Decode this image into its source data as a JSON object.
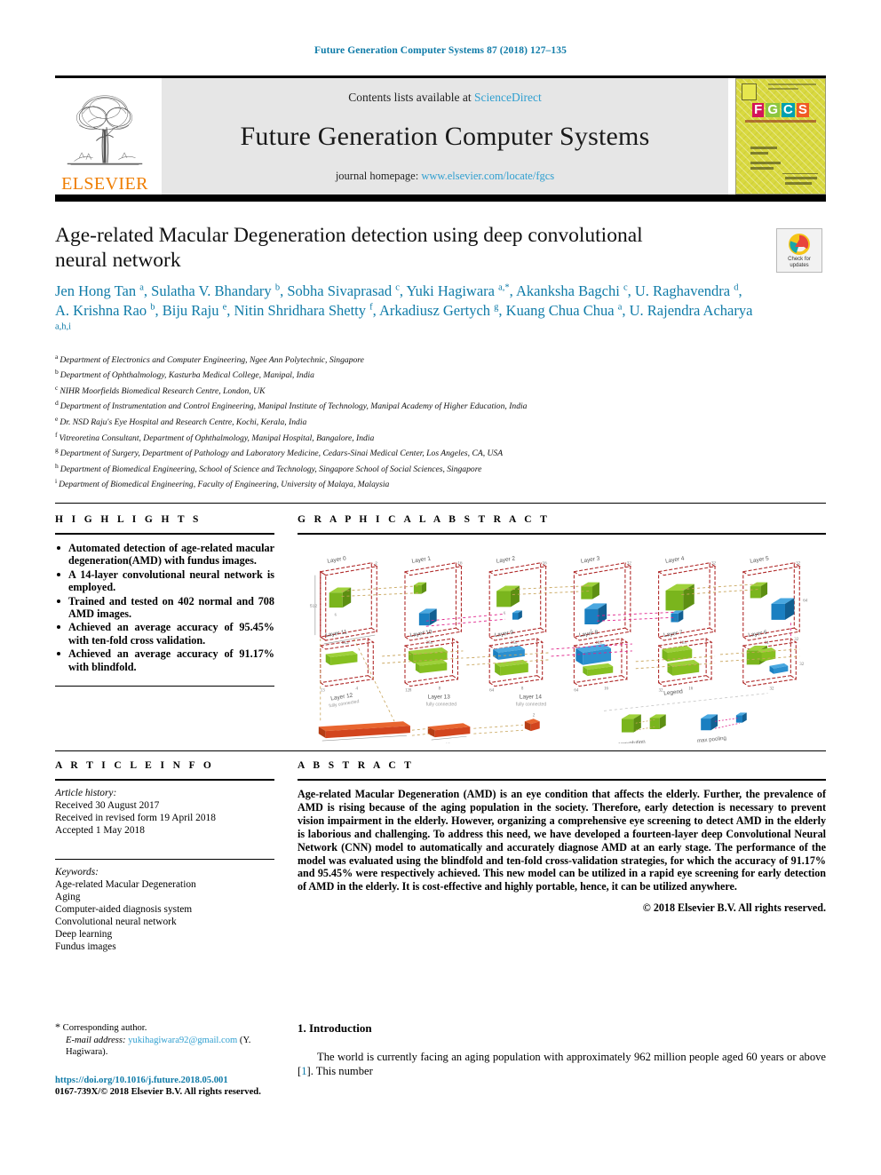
{
  "running_head": "Future Generation Computer Systems 87 (2018) 127–135",
  "masthead": {
    "elsevier_wordmark": "ELSEVIER",
    "contents_prefix": "Contents lists available at",
    "contents_link": "ScienceDirect",
    "journal_title": "Future Generation Computer Systems",
    "homepage_prefix": "journal homepage:",
    "homepage_link": "www.elsevier.com/locate/fgcs",
    "cover_letters": [
      "F",
      "G",
      "C",
      "S"
    ],
    "cover_letter_colors": [
      "#d4145a",
      "#8dc63f",
      "#00a0b0",
      "#f15a24"
    ]
  },
  "article": {
    "title": "Age-related Macular Degeneration detection using deep convolutional neural network",
    "authors_html": "Jen Hong Tan <sup>a</sup>, Sulatha V. Bhandary <sup>b</sup>, Sobha Sivaprasad <sup>c</sup>, Yuki Hagiwara <sup>a,*</sup>, Akanksha Bagchi <sup>c</sup>, U. Raghavendra <sup>d</sup>, A. Krishna Rao <sup>b</sup>, Biju Raju <sup>e</sup>, Nitin Shridhara Shetty <sup>f</sup>, Arkadiusz Gertych <sup>g</sup>, Kuang Chua Chua <sup>a</sup>, U. Rajendra Acharya <sup>a,h,i</sup>",
    "crossmark_label": "Check for\nupdates"
  },
  "affiliations": [
    {
      "mark": "a",
      "text": "Department of Electronics and Computer Engineering, Ngee Ann Polytechnic, Singapore"
    },
    {
      "mark": "b",
      "text": "Department of Ophthalmology, Kasturba Medical College, Manipal, India"
    },
    {
      "mark": "c",
      "text": "NIHR Moorfields Biomedical Research Centre, London, UK"
    },
    {
      "mark": "d",
      "text": "Department of Instrumentation and Control Engineering, Manipal Institute of Technology, Manipal Academy of Higher Education, India"
    },
    {
      "mark": "e",
      "text": "Dr. NSD Raju's Eye Hospital and Research Centre, Kochi, Kerala, India"
    },
    {
      "mark": "f",
      "text": "Vitreoretina Consultant, Department of Ophthalmology, Manipal Hospital, Bangalore, India"
    },
    {
      "mark": "g",
      "text": "Department of Surgery, Department of Pathology and Laboratory Medicine, Cedars-Sinai Medical Center, Los Angeles, CA, USA"
    },
    {
      "mark": "h",
      "text": "Department of Biomedical Engineering, School of Science and Technology, Singapore School of Social Sciences, Singapore"
    },
    {
      "mark": "i",
      "text": "Department of Biomedical Engineering, Faculty of Engineering, University of Malaya, Malaysia"
    }
  ],
  "highlights": {
    "heading": "H I G H L I G H T S",
    "items": [
      "Automated detection of age-related macular degeneration(AMD) with fundus images.",
      "A 14-layer convolutional neural network is employed.",
      "Trained and tested on 402 normal and 708 AMD images.",
      "Achieved an average accuracy of 95.45% with ten-fold cross validation.",
      "Achieved an average accuracy of 91.17% with blindfold."
    ]
  },
  "graphical_abstract": {
    "heading": "G R A P H I C A L    A B S T R A C T",
    "row1_layers": [
      "Layer 0",
      "Layer 1",
      "Layer 2",
      "Layer 3",
      "Layer 4",
      "Layer 5"
    ],
    "row2_layers": [
      "Layer 11",
      "Layer 10",
      "Layer 9",
      "Layer 8",
      "Layer 7",
      "Layer 6"
    ],
    "row3_layers": [
      {
        "name": "Layer 12",
        "sub": "fully connected"
      },
      {
        "name": "Layer 13",
        "sub": "fully connected"
      },
      {
        "name": "Layer 14",
        "sub": "fully connected"
      }
    ],
    "legend_title": "Legend",
    "legend_items": [
      {
        "label": "convolution",
        "color": "#7ab51d"
      },
      {
        "label": "max pooling",
        "color": "#1a7fc1"
      }
    ],
    "dim_labels_row1": [
      "512",
      "256",
      "128",
      "64",
      "32",
      "16"
    ],
    "dim_labels_row3": [
      "128",
      "16",
      "2"
    ]
  },
  "article_info": {
    "heading": "A R T I C L E    I N F O",
    "history_label": "Article history:",
    "history": [
      "Received 30 August 2017",
      "Received in revised form 19 April 2018",
      "Accepted 1 May 2018"
    ],
    "keywords_label": "Keywords:",
    "keywords": [
      "Age-related Macular Degeneration",
      "Aging",
      "Computer-aided diagnosis system",
      "Convolutional neural network",
      "Deep learning",
      "Fundus images"
    ]
  },
  "abstract": {
    "heading": "A B S T R A C T",
    "body": "Age-related Macular Degeneration (AMD) is an eye condition that affects the elderly. Further, the prevalence of AMD is rising because of the aging population in the society. Therefore, early detection is necessary to prevent vision impairment in the elderly. However, organizing a comprehensive eye screening to detect AMD in the elderly is laborious and challenging. To address this need, we have developed a fourteen-layer deep Convolutional Neural Network (CNN) model to automatically and accurately diagnose AMD at an early stage. The performance of the model was evaluated using the blindfold and ten-fold cross-validation strategies, for which the accuracy of 91.17% and 95.45% were respectively achieved. This new model can be utilized in a rapid eye screening for early detection of AMD in the elderly. It is cost-effective and highly portable, hence, it can be utilized anywhere.",
    "copyright": "© 2018 Elsevier B.V. All rights reserved."
  },
  "introduction": {
    "heading": "1.  Introduction",
    "paragraph_part1": "The world is currently facing an aging population with approximately 962 million people aged 60 years or above [",
    "citation": "1",
    "paragraph_part2": "]. This number"
  },
  "footer": {
    "corresponding_marker": "*",
    "corresponding_text": "Corresponding author.",
    "email_label": "E-mail address:",
    "email": "yukihagiwara92@gmail.com",
    "email_owner": "(Y. Hagiwara).",
    "doi": "https://doi.org/10.1016/j.future.2018.05.001",
    "issn_line": "0167-739X/© 2018 Elsevier B.V. All rights reserved."
  },
  "colors": {
    "link_blue": "#0f7ba8",
    "light_blue": "#2f9fd0",
    "elsevier_orange": "#ef7d00",
    "cover_yellow": "#d9d93f",
    "conv_green": "#7ab51d",
    "pool_blue": "#1a7fc1",
    "fc_red": "#d2451e"
  }
}
